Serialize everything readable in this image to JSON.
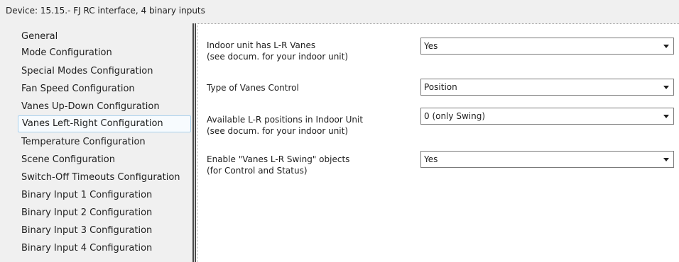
{
  "header": {
    "title": "Device: 15.15.-  FJ RC interface, 4 binary inputs"
  },
  "sidebar": {
    "items": [
      {
        "label": "General"
      },
      {
        "label": "Mode Configuration"
      },
      {
        "label": "Special Modes Configuration"
      },
      {
        "label": "Fan Speed Configuration"
      },
      {
        "label": "Vanes Up-Down Configuration"
      },
      {
        "label": "Vanes Left-Right Configuration"
      },
      {
        "label": "Temperature Configuration"
      },
      {
        "label": "Scene Configuration"
      },
      {
        "label": "Switch-Off Timeouts Configuration"
      },
      {
        "label": "Binary Input 1 Configuration"
      },
      {
        "label": "Binary Input 2 Configuration"
      },
      {
        "label": "Binary Input 3 Configuration"
      },
      {
        "label": "Binary Input 4 Configuration"
      }
    ],
    "selected_label": "Vanes Left-Right Configuration"
  },
  "params": [
    {
      "label_line1": "Indoor unit has L-R Vanes",
      "label_line2": "(see docum. for your indoor unit)",
      "value": "Yes"
    },
    {
      "label_line1": "Type of Vanes Control",
      "label_line2": "",
      "value": "Position"
    },
    {
      "label_line1": "Available L-R positions in Indoor Unit",
      "label_line2": "(see docum. for your indoor unit)",
      "value": "0 (only Swing)"
    },
    {
      "label_line1": "Enable \"Vanes L-R Swing\" objects",
      "label_line2": "(for Control and Status)",
      "value": "Yes"
    }
  ]
}
